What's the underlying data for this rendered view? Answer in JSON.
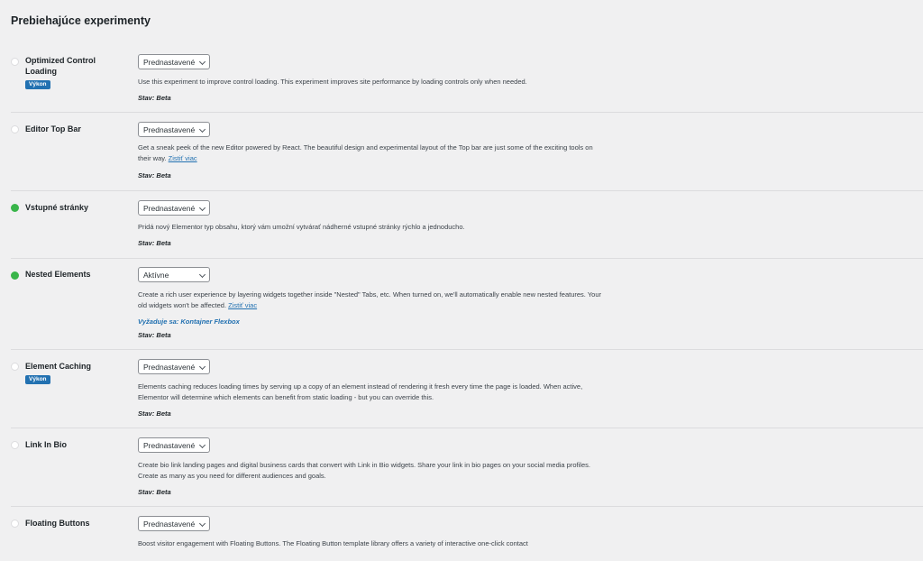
{
  "page_title": "Prebiehajúce experimenty",
  "status_prefix": "Stav:",
  "experiments": [
    {
      "name": "Optimized Control Loading",
      "tag": "Výkon",
      "select_value": "Prednastavené",
      "active": false,
      "description": "Use this experiment to improve control loading. This experiment improves site performance by loading controls only when needed.",
      "link": "",
      "requires": "",
      "status": "Stav: Beta"
    },
    {
      "name": "Editor Top Bar",
      "tag": "",
      "select_value": "Prednastavené",
      "active": false,
      "description": "Get a sneak peek of the new Editor powered by React. The beautiful design and experimental layout of the Top bar are just some of the exciting tools on their way.",
      "link": "Zistiť viac",
      "requires": "",
      "status": "Stav: Beta"
    },
    {
      "name": "Vstupné stránky",
      "tag": "",
      "select_value": "Prednastavené",
      "active": true,
      "description": "Pridá nový Elementor typ obsahu, ktorý vám umožní vytvárať nádherné vstupné stránky rýchlo a jednoducho.",
      "link": "",
      "requires": "",
      "status": "Stav: Beta"
    },
    {
      "name": "Nested Elements",
      "tag": "",
      "select_value": "Aktívne",
      "active": true,
      "description": "Create a rich user experience by layering widgets together inside \"Nested\" Tabs, etc. When turned on, we'll automatically enable new nested features. Your old widgets won't be affected.",
      "link": "Zistiť viac",
      "requires": "Vyžaduje sa: Kontajner Flexbox",
      "status": "Stav: Beta"
    },
    {
      "name": "Element Caching",
      "tag": "Výkon",
      "select_value": "Prednastavené",
      "active": false,
      "description": "Elements caching reduces loading times by serving up a copy of an element instead of rendering it fresh every time the page is loaded. When active, Elementor will determine which elements can benefit from static loading - but you can override this.",
      "link": "",
      "requires": "",
      "status": "Stav: Beta"
    },
    {
      "name": "Link In Bio",
      "tag": "",
      "select_value": "Prednastavené",
      "active": false,
      "description": "Create bio link landing pages and digital business cards that convert with Link in Bio widgets. Share your link in bio pages on your social media profiles. Create as many as you need for different audiences and goals.",
      "link": "",
      "requires": "",
      "status": "Stav: Beta"
    },
    {
      "name": "Floating Buttons",
      "tag": "",
      "select_value": "Prednastavené",
      "active": false,
      "description": "Boost visitor engagement with Floating Buttons. The Floating Button template library offers a variety of interactive one-click contact",
      "link": "",
      "requires": "",
      "status": ""
    }
  ]
}
